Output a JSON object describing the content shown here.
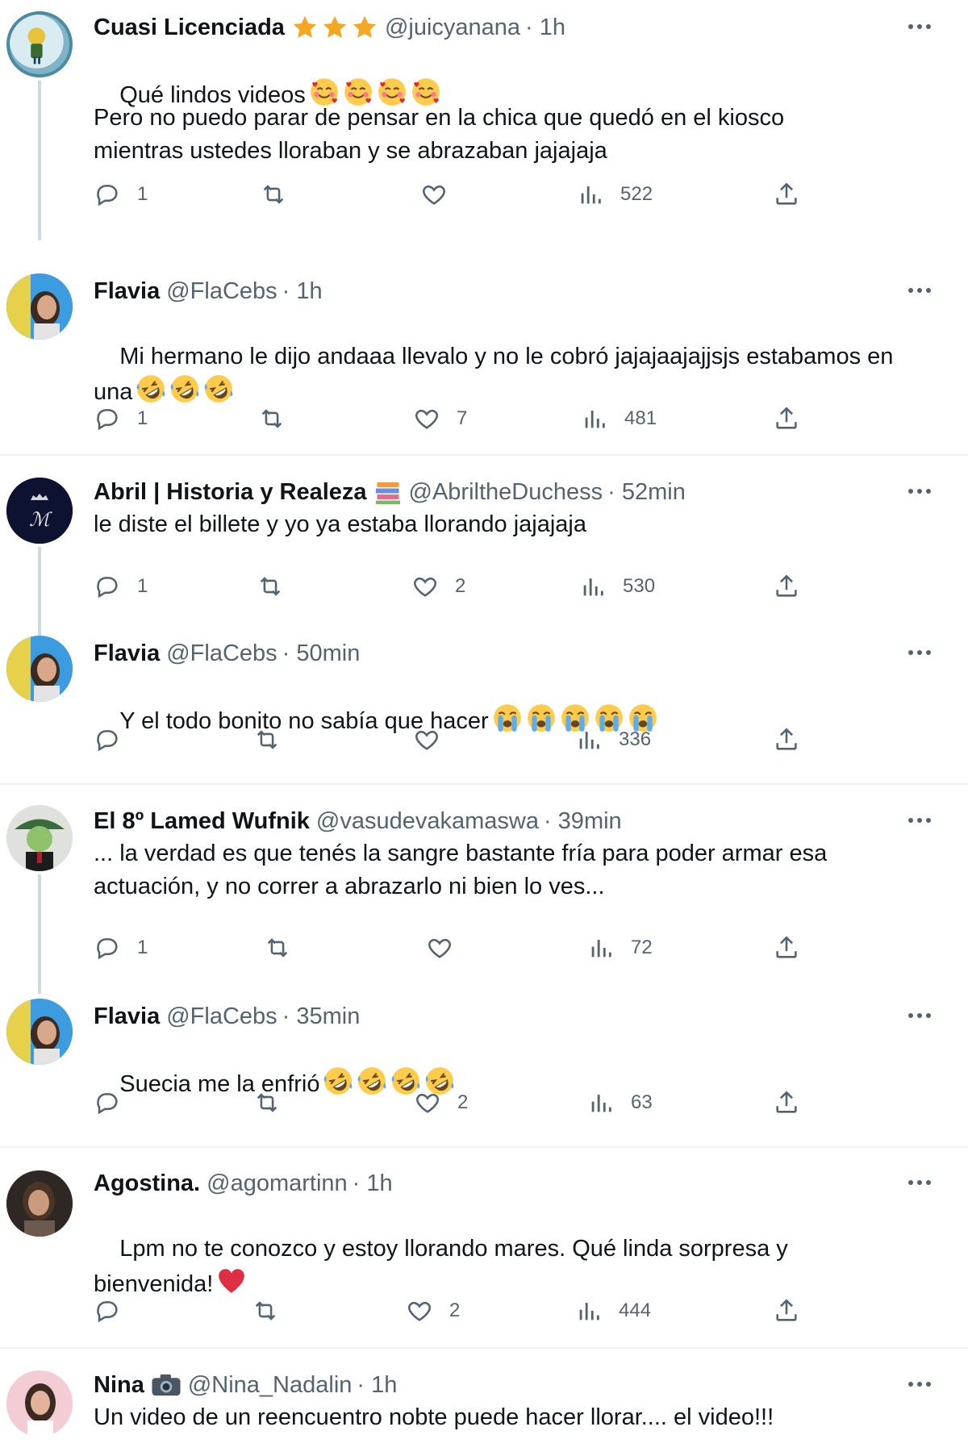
{
  "replies": [
    {
      "name": "Cuasi Licenciada",
      "badge": "three-stars",
      "handle": "@juicyanana",
      "time": "· 1h",
      "text": "Qué lindos videos",
      "text_emoji": "smiling-face-with-hearts",
      "text_emoji_count": 4,
      "text2": "Pero no puedo parar de pensar en la chica que quedó en el kiosco\nmientras ustedes lloraban y se abrazaban jajajaja",
      "replies": "1",
      "reposts": "",
      "likes": "",
      "views": "522"
    },
    {
      "name": "Flavia",
      "handle": "@FlaCebs",
      "time": "· 1h",
      "text": "Mi hermano le dijo andaaa llevalo y no le cobró jajajaajajjsjs estabamos en\nuna",
      "text_emoji": "rolling-laughing-face",
      "text_emoji_count": 3,
      "replies": "1",
      "reposts": "",
      "likes": "7",
      "views": "481"
    },
    {
      "name": "Abril | Historia y Realeza",
      "badge": "books-emoji",
      "handle": "@AbriltheDuchess",
      "time": "· 52min",
      "text": "le diste el billete y yo ya estaba llorando jajajaja",
      "replies": "1",
      "reposts": "",
      "likes": "2",
      "views": "530"
    },
    {
      "name": "Flavia",
      "handle": "@FlaCebs",
      "time": "· 50min",
      "text": "Y el todo bonito no sabía que hacer",
      "text_emoji": "loudly-crying-face",
      "text_emoji_count": 5,
      "replies": "",
      "reposts": "",
      "likes": "",
      "views": "336"
    },
    {
      "name": "El 8º Lamed Wufnik",
      "handle": "@vasudevakamaswa",
      "time": "· 39min",
      "text": "... la verdad es que tenés la sangre bastante fría para poder armar esa\nactuación, y no correr a abrazarlo ni bien lo ves...",
      "replies": "1",
      "reposts": "",
      "likes": "",
      "views": "72"
    },
    {
      "name": "Flavia",
      "handle": "@FlaCebs",
      "time": "· 35min",
      "text": "Suecia me la enfrió",
      "text_emoji": "rolling-laughing-face",
      "text_emoji_count": 4,
      "replies": "",
      "reposts": "",
      "likes": "2",
      "views": "63"
    },
    {
      "name": "Agostina.",
      "handle": "@agomartinn",
      "time": "· 1h",
      "text": "Lpm no te conozco y estoy llorando mares. Qué linda sorpresa y\nbienvenida!",
      "text_emoji": "red-heart",
      "text_emoji_count": 1,
      "replies": "",
      "reposts": "",
      "likes": "2",
      "views": "444"
    },
    {
      "name": "Nina",
      "badge": "camera-emoji",
      "handle": "@Nina_Nadalin",
      "time": "· 1h",
      "text": "Un video de un reencuentro nobte puede hacer llorar.... el video!!!"
    }
  ],
  "colors": {
    "text": "#0f1419",
    "muted": "#536471",
    "divider": "#eff3f4",
    "thread": "#cfd9de"
  }
}
